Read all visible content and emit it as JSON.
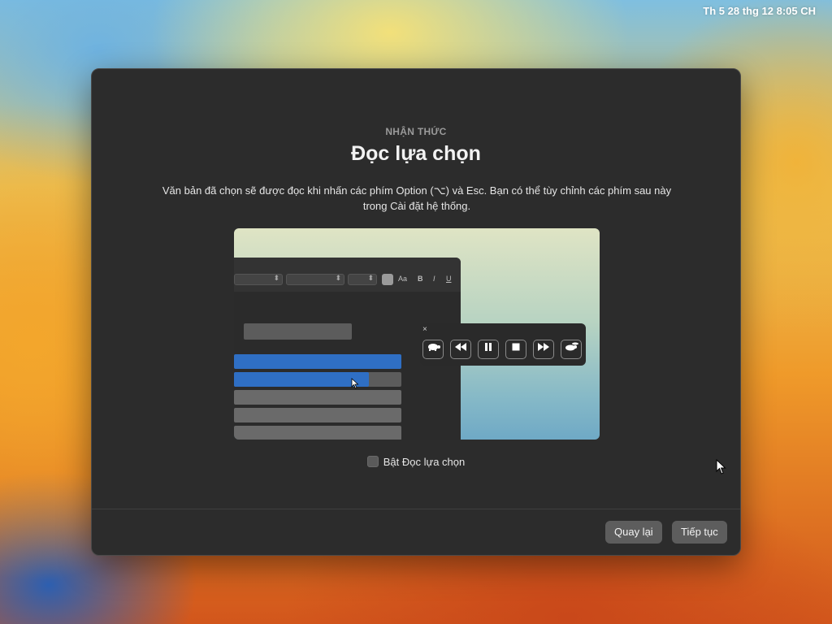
{
  "menubar": {
    "datetime": "Th 5 28 thg 12 8:05 CH"
  },
  "dialog": {
    "eyebrow": "NHẬN THỨC",
    "title": "Đọc lựa chọn",
    "description": "Văn bản đã chọn sẽ được đọc khi nhấn các phím Option (⌥) và Esc. Bạn có thể tùy chỉnh các phím sau này trong Cài đặt hệ thống.",
    "illustration": {
      "font_size_label": "Aa",
      "bold": "B",
      "italic": "I",
      "underline": "U",
      "player_close": "×",
      "player_buttons": [
        "turtle-icon",
        "rewind-icon",
        "pause-icon",
        "stop-icon",
        "fast-forward-icon",
        "rabbit-icon"
      ]
    },
    "checkbox": {
      "label": "Bật Đọc lựa chọn",
      "checked": false
    },
    "buttons": {
      "back": "Quay lại",
      "continue": "Tiếp tục"
    }
  },
  "colors": {
    "dialog_bg": "#2c2c2c",
    "button_bg": "#5d5d5d",
    "highlight_blue": "#2f6fc4"
  }
}
